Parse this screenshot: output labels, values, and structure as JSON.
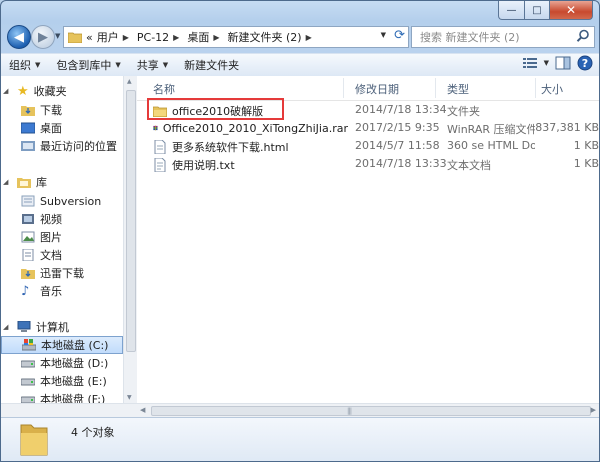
{
  "window": {
    "controls": {
      "minimize": "—",
      "maximize": "□",
      "close": "✕"
    }
  },
  "address": {
    "prefix": "«",
    "crumbs": [
      "用户",
      "PC-12",
      "桌面",
      "新建文件夹 (2)"
    ]
  },
  "search": {
    "placeholder": "搜索 新建文件夹 (2)"
  },
  "toolbar": {
    "organize": "组织",
    "include_library": "包含到库中",
    "share": "共享",
    "new_folder": "新建文件夹"
  },
  "nav": {
    "favorites": {
      "label": "收藏夹",
      "items": [
        "下载",
        "桌面",
        "最近访问的位置"
      ]
    },
    "libraries": {
      "label": "库",
      "items": [
        "Subversion",
        "视频",
        "图片",
        "文档",
        "迅雷下载",
        "音乐"
      ]
    },
    "computer": {
      "label": "计算机",
      "items": [
        "本地磁盘 (C:)",
        "本地磁盘 (D:)",
        "本地磁盘 (E:)",
        "本地磁盘 (F:)"
      ]
    }
  },
  "columns": {
    "name": "名称",
    "date": "修改日期",
    "type": "类型",
    "size": "大小"
  },
  "files": [
    {
      "name": "office2010破解版",
      "date": "2014/7/18 13:34",
      "type": "文件夹",
      "size": "",
      "icon": "folder-icon"
    },
    {
      "name": "Office2010_2010_XiTongZhiJia.rar",
      "date": "2017/2/15 9:35",
      "type": "WinRAR 压缩文件",
      "size": "837,381 KB",
      "icon": "rar-icon"
    },
    {
      "name": "更多系统软件下载.html",
      "date": "2014/5/7 11:58",
      "type": "360 se HTML Do...",
      "size": "1 KB",
      "icon": "html-icon"
    },
    {
      "name": "使用说明.txt",
      "date": "2014/7/18 13:33",
      "type": "文本文档",
      "size": "1 KB",
      "icon": "txt-icon"
    }
  ],
  "status": {
    "count": "4 个对象"
  },
  "colors": {
    "highlight": "#e53a3a",
    "selection": "#c1dcfb",
    "chrome": "#b9d1ea"
  }
}
